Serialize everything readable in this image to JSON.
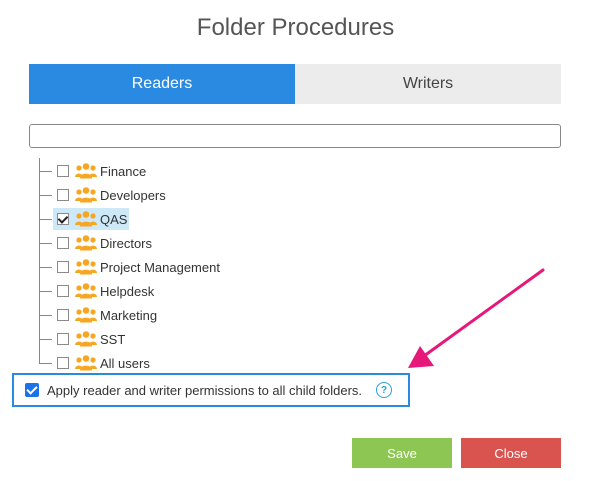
{
  "dialog": {
    "title": "Folder Procedures"
  },
  "tabs": [
    {
      "label": "Readers",
      "active": true
    },
    {
      "label": "Writers",
      "active": false
    }
  ],
  "search": {
    "value": "",
    "placeholder": ""
  },
  "groups": [
    {
      "label": "Finance",
      "checked": false
    },
    {
      "label": "Developers",
      "checked": false
    },
    {
      "label": "QAS",
      "checked": true
    },
    {
      "label": "Directors",
      "checked": false
    },
    {
      "label": "Project Management",
      "checked": false
    },
    {
      "label": "Helpdesk",
      "checked": false
    },
    {
      "label": "Marketing",
      "checked": false
    },
    {
      "label": "SST",
      "checked": false
    },
    {
      "label": "All users",
      "checked": false
    }
  ],
  "options": {
    "apply_child_label": "Apply reader and writer permissions to all child folders.",
    "apply_child_checked": true,
    "help_symbol": "?"
  },
  "buttons": {
    "save_label": "Save",
    "close_label": "Close"
  },
  "colors": {
    "accent": "#2a8ae2",
    "group_icon": "#f5a623",
    "save": "#8dc653",
    "close": "#d9534f",
    "annotation_arrow": "#e6187a"
  },
  "icons": {
    "group": "user-group-icon",
    "help": "help-icon",
    "arrow": "annotation-arrow"
  }
}
